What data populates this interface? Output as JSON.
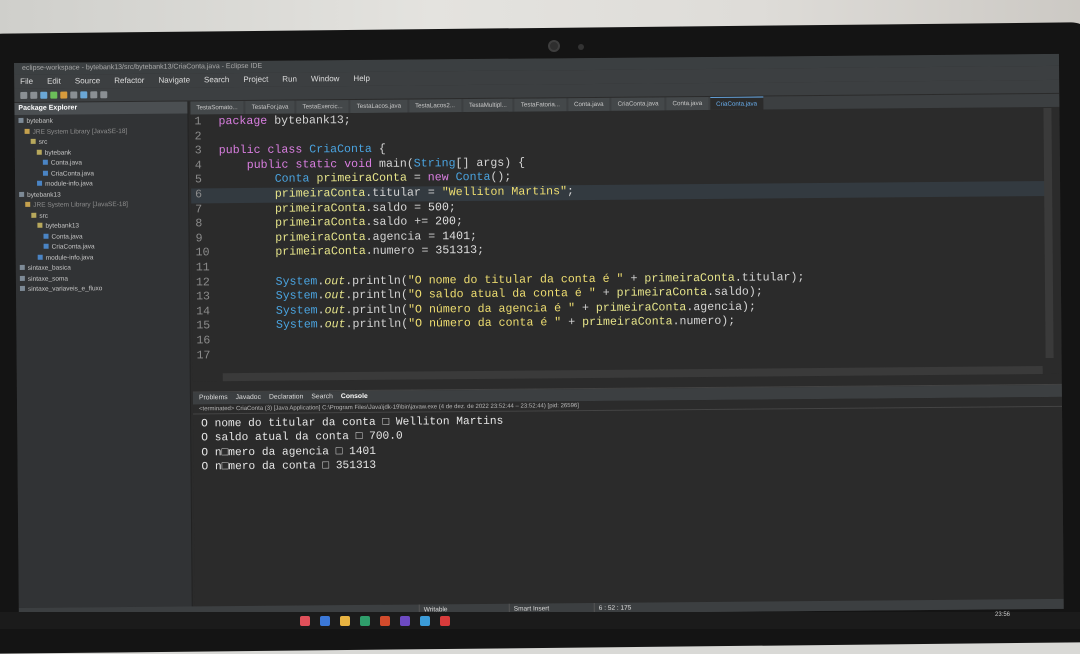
{
  "window": {
    "title": "eclipse-workspace - bytebank13/src/bytebank13/CriaConta.java - Eclipse IDE"
  },
  "menu": [
    "File",
    "Edit",
    "Source",
    "Refactor",
    "Navigate",
    "Search",
    "Project",
    "Run",
    "Window",
    "Help"
  ],
  "explorer": {
    "tab": "Package Explorer",
    "tree": [
      {
        "label": "bytebank",
        "cls": ""
      },
      {
        "label": "JRE System Library [JavaSE-18]",
        "cls": "lib"
      },
      {
        "label": "src",
        "cls": ""
      },
      {
        "label": "bytebank",
        "cls": ""
      },
      {
        "label": "Conta.java",
        "cls": ""
      },
      {
        "label": "CriaConta.java",
        "cls": ""
      },
      {
        "label": "module-info.java",
        "cls": ""
      },
      {
        "label": "bytebank13",
        "cls": ""
      },
      {
        "label": "JRE System Library [JavaSE-18]",
        "cls": "lib"
      },
      {
        "label": "src",
        "cls": ""
      },
      {
        "label": "bytebank13",
        "cls": ""
      },
      {
        "label": "Conta.java",
        "cls": ""
      },
      {
        "label": "CriaConta.java",
        "cls": ""
      },
      {
        "label": "module-info.java",
        "cls": ""
      },
      {
        "label": "sintaxe_basica",
        "cls": ""
      },
      {
        "label": "sintaxe_soma",
        "cls": ""
      },
      {
        "label": "sintaxe_variaveis_e_fluxo",
        "cls": ""
      }
    ]
  },
  "editor": {
    "tabs": [
      "TestaSomato...",
      "TestaFor.java",
      "TestaExercic...",
      "TestaLacos.java",
      "TestaLacos2...",
      "TestaMultipl...",
      "TestaFatoria...",
      "Conta.java",
      "CriaConta.java",
      "Conta.java",
      "CriaConta.java"
    ],
    "active_tab": "CriaConta.java",
    "line_numbers": [
      "1",
      "2",
      "3",
      "4",
      "5",
      "6",
      "7",
      "8",
      "9",
      "10",
      "11",
      "12",
      "13",
      "14",
      "15",
      "16",
      "17"
    ],
    "lines": [
      "package bytebank13;",
      "",
      "public class CriaConta {",
      "    public static void main(String[] args) {",
      "        Conta primeiraConta = new Conta();",
      "        primeiraConta.titular = \"Welliton Martins\";",
      "        primeiraConta.saldo = 500;",
      "        primeiraConta.saldo += 200;",
      "        primeiraConta.agencia = 1401;",
      "        primeiraConta.numero = 351313;",
      "",
      "        System.out.println(\"O nome do titular da conta é \" + primeiraConta.titular);",
      "        System.out.println(\"O saldo atual da conta é \" + primeiraConta.saldo);",
      "        System.out.println(\"O número da agencia é \" + primeiraConta.agencia);",
      "        System.out.println(\"O número da conta é \" + primeiraConta.numero);",
      "",
      ""
    ]
  },
  "bottom": {
    "tabs": [
      "Problems",
      "Javadoc",
      "Declaration",
      "Search",
      "Console"
    ],
    "terminated": "<terminated> CriaConta (3) [Java Application] C:\\Program Files\\Java\\jdk-19\\bin\\javaw.exe  (4 de dez. de 2022 23:52:44 – 23:52:44) [pid: 26596]",
    "output": [
      "O nome do titular da conta □ Welliton Martins",
      "O saldo atual da conta □ 700.0",
      "O n□mero da agencia □ 1401",
      "O n□mero da conta □ 351313"
    ]
  },
  "status": {
    "mode": "Writable",
    "insert": "Smart Insert",
    "position": "6 : 52 : 175"
  },
  "clock": {
    "time": "23:56"
  }
}
